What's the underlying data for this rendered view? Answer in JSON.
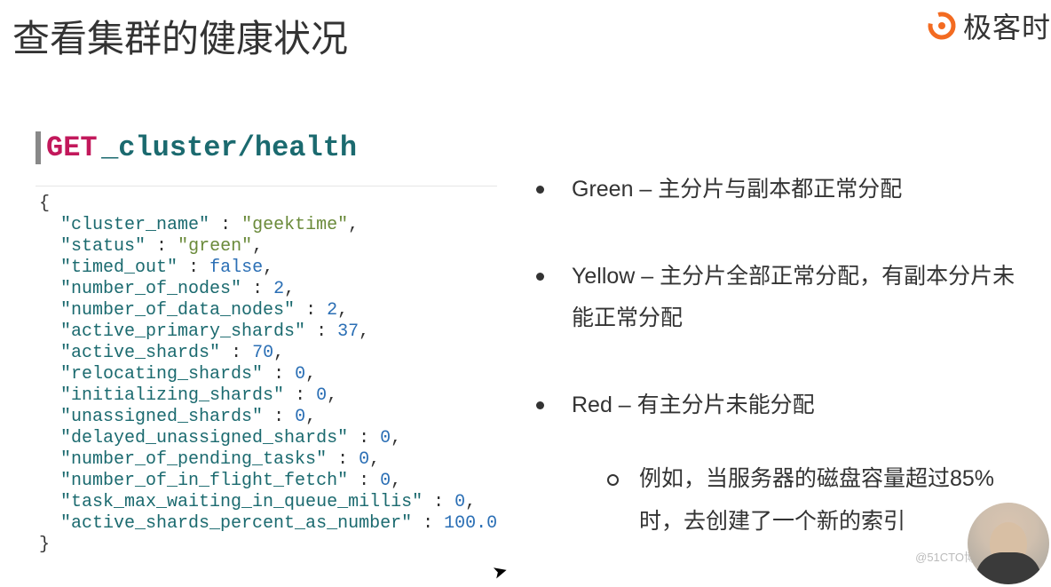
{
  "title": "查看集群的健康状况",
  "brand": "极客时",
  "request": {
    "method": "GET",
    "path": "_cluster/health"
  },
  "response": {
    "fields": [
      {
        "key": "cluster_name",
        "value": "geektime",
        "type": "str"
      },
      {
        "key": "status",
        "value": "green",
        "type": "str"
      },
      {
        "key": "timed_out",
        "value": "false",
        "type": "bool"
      },
      {
        "key": "number_of_nodes",
        "value": "2",
        "type": "num"
      },
      {
        "key": "number_of_data_nodes",
        "value": "2",
        "type": "num"
      },
      {
        "key": "active_primary_shards",
        "value": "37",
        "type": "num"
      },
      {
        "key": "active_shards",
        "value": "70",
        "type": "num"
      },
      {
        "key": "relocating_shards",
        "value": "0",
        "type": "num"
      },
      {
        "key": "initializing_shards",
        "value": "0",
        "type": "num"
      },
      {
        "key": "unassigned_shards",
        "value": "0",
        "type": "num"
      },
      {
        "key": "delayed_unassigned_shards",
        "value": "0",
        "type": "num"
      },
      {
        "key": "number_of_pending_tasks",
        "value": "0",
        "type": "num"
      },
      {
        "key": "number_of_in_flight_fetch",
        "value": "0",
        "type": "num"
      },
      {
        "key": "task_max_waiting_in_queue_millis",
        "value": "0",
        "type": "num"
      },
      {
        "key": "active_shards_percent_as_number",
        "value": "100.0",
        "type": "num"
      }
    ]
  },
  "bullets": [
    {
      "text": "Green – 主分片与副本都正常分配"
    },
    {
      "text": "Yellow – 主分片全部正常分配，有副本分片未能正常分配"
    },
    {
      "text": "Red – 有主分片未能分配",
      "sub": [
        {
          "text": "例如，当服务器的磁盘容量超过85%时，去创建了一个新的索引"
        }
      ]
    }
  ],
  "watermark": "@51CTO博客"
}
